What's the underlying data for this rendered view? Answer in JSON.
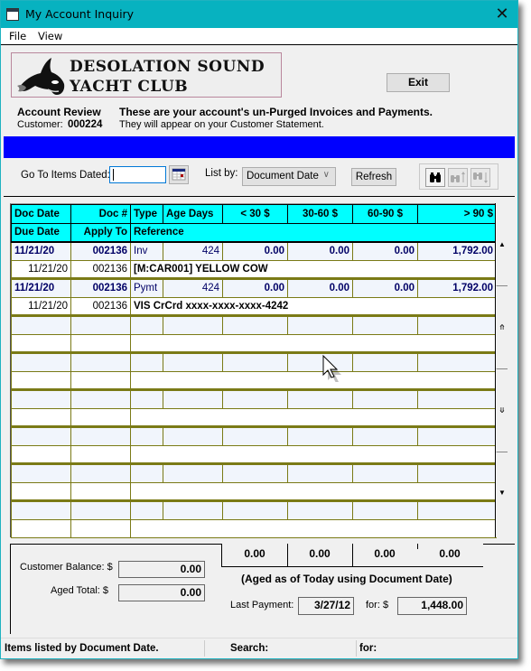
{
  "window": {
    "title": "My Account Inquiry",
    "close_glyph": "✕"
  },
  "menu": {
    "items": [
      "File",
      "View"
    ]
  },
  "logo": {
    "line1": "DESOLATION SOUND",
    "line2": "YACHT CLUB"
  },
  "header": {
    "exit_label": "Exit",
    "review_title": "Account Review",
    "customer_label": "Customer:",
    "customer_id": "000224",
    "notice_line1": "These are your account's un-Purged Invoices and Payments.",
    "notice_line2": "They will appear on your Customer Statement."
  },
  "toolbar": {
    "goto_label": "Go To Items Dated:",
    "goto_value": "",
    "listby_label": "List by:",
    "listby_selected": "Document Date",
    "refresh_label": "Refresh",
    "search_icons": [
      "binoculars-icon",
      "binoculars-up-icon",
      "binoculars-down-icon"
    ]
  },
  "grid": {
    "header_row1": [
      "Doc Date",
      "Doc #",
      "Type",
      "Age Days",
      "< 30 $",
      "30-60 $",
      "60-90 $",
      "> 90 $"
    ],
    "header_row2": [
      "Due Date",
      "Apply To",
      "Reference"
    ],
    "records": [
      {
        "doc_date": "11/21/20",
        "doc_no": "002136",
        "type": "Inv",
        "age_days": "424",
        "lt30": "0.00",
        "d30_60": "0.00",
        "d60_90": "0.00",
        "gt90": "1,792.00",
        "due_date": "11/21/20",
        "apply_to": "002136",
        "reference": "[M:CAR001] YELLOW COW"
      },
      {
        "doc_date": "11/21/20",
        "doc_no": "002136",
        "type": "Pymt",
        "age_days": "424",
        "lt30": "0.00",
        "d30_60": "0.00",
        "d60_90": "0.00",
        "gt90": "1,792.00",
        "due_date": "11/21/20",
        "apply_to": "002136",
        "reference": "VIS CrCrd xxxx-xxxx-xxxx-4242"
      }
    ],
    "empty_record_count": 6
  },
  "footer": {
    "customer_balance_label": "Customer Balance:  $",
    "customer_balance": "0.00",
    "aged_total_label": "Aged Total:  $",
    "aged_total": "0.00",
    "totals": [
      "0.00",
      "0.00",
      "0.00",
      "0.00"
    ],
    "aged_note": "(Aged as of Today using Document Date)",
    "last_payment_label": "Last Payment:",
    "last_payment_date": "3/27/12",
    "for_label": "for:  $",
    "last_payment_amount": "1,448.00"
  },
  "status": {
    "listed_by": "Items listed by Document Date.",
    "search_label": "Search:",
    "for_label": "for:"
  }
}
